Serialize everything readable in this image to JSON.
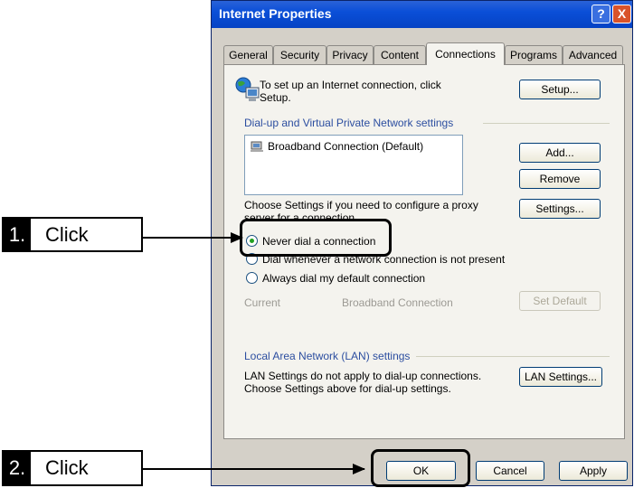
{
  "window": {
    "title": "Internet Properties",
    "help_glyph": "?",
    "close_glyph": "X"
  },
  "tabs": [
    "General",
    "Security",
    "Privacy",
    "Content",
    "Connections",
    "Programs",
    "Advanced"
  ],
  "active_tab": "Connections",
  "setup": {
    "text_line1": "To set up an Internet connection, click",
    "text_line2": "Setup.",
    "button": "Setup..."
  },
  "dialup": {
    "group_label": "Dial-up and Virtual Private Network settings",
    "connections": [
      "Broadband Connection (Default)"
    ],
    "add_button": "Add...",
    "remove_button": "Remove",
    "settings_text_line1": "Choose Settings if you need to configure a proxy",
    "settings_text_line2": "server for a connection.",
    "settings_button": "Settings...",
    "radio_options": [
      {
        "label": "Never dial a connection",
        "selected": true
      },
      {
        "label": "Dial whenever a network connection is not present",
        "selected": false
      },
      {
        "label": "Always dial my default connection",
        "selected": false
      }
    ],
    "current_label": "Current",
    "current_value": "Broadband Connection",
    "set_default_button": "Set Default"
  },
  "lan": {
    "group_label": "Local Area Network (LAN) settings",
    "text_line1": "LAN Settings do not apply to dial-up connections.",
    "text_line2": "Choose Settings above for dial-up settings.",
    "button": "LAN Settings..."
  },
  "footer": {
    "ok": "OK",
    "cancel": "Cancel",
    "apply": "Apply"
  },
  "callouts": [
    {
      "num": "1.",
      "word": "Click"
    },
    {
      "num": "2.",
      "word": "Click"
    }
  ],
  "colors": {
    "titlebar": "#0a4fd8",
    "dialog_bg": "#d4d0c8",
    "panel_bg": "#f4f3ee",
    "radio_dot": "#21a121"
  }
}
